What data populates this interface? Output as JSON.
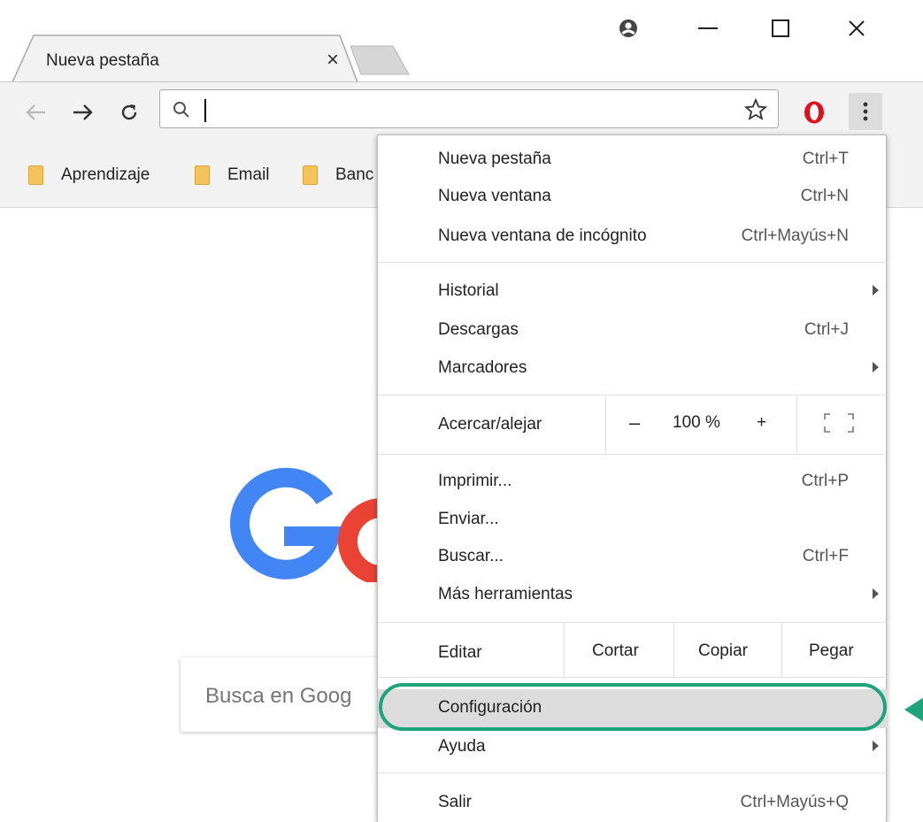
{
  "tab": {
    "title": "Nueva pestaña",
    "close": "×"
  },
  "window": {
    "minimize": "—",
    "maximize": "☐",
    "close": "✕"
  },
  "omnibox": {
    "value": "",
    "placeholder": ""
  },
  "bookmarks": [
    "Aprendizaje",
    "Email",
    "Banc"
  ],
  "page": {
    "search_placeholder": "Busca en Goog"
  },
  "menu": {
    "group1": [
      {
        "label": "Nueva pestaña",
        "shortcut": "Ctrl+T"
      },
      {
        "label": "Nueva ventana",
        "shortcut": "Ctrl+N"
      },
      {
        "label": "Nueva ventana de incógnito",
        "shortcut": "Ctrl+Mayús+N"
      }
    ],
    "group2": [
      {
        "label": "Historial",
        "shortcut": ""
      },
      {
        "label": "Descargas",
        "shortcut": "Ctrl+J"
      },
      {
        "label": "Marcadores",
        "shortcut": ""
      }
    ],
    "zoom": {
      "label": "Acercar/alejar",
      "minus": "–",
      "value": "100 %",
      "plus": "+"
    },
    "group3": [
      {
        "label": "Imprimir...",
        "shortcut": "Ctrl+P"
      },
      {
        "label": "Enviar...",
        "shortcut": ""
      },
      {
        "label": "Buscar...",
        "shortcut": "Ctrl+F"
      },
      {
        "label": "Más herramientas",
        "shortcut": ""
      }
    ],
    "edit": {
      "label": "Editar",
      "cut": "Cortar",
      "copy": "Copiar",
      "paste": "Pegar"
    },
    "group4": [
      {
        "label": "Configuración",
        "shortcut": ""
      },
      {
        "label": "Ayuda",
        "shortcut": ""
      }
    ],
    "exit": {
      "label": "Salir",
      "shortcut": "Ctrl+Mayús+Q"
    }
  },
  "colors": {
    "highlight": "#1fa37a",
    "folder": "#f5c35b",
    "opera_red": "#e0111f",
    "google_blue": "#4285f4",
    "google_red": "#ea4335"
  }
}
